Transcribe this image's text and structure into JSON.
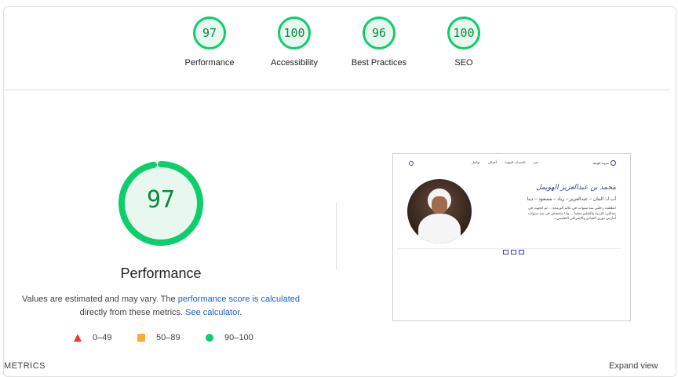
{
  "categories": [
    {
      "score": "97",
      "label": "Performance"
    },
    {
      "score": "100",
      "label": "Accessibility"
    },
    {
      "score": "96",
      "label": "Best Practices"
    },
    {
      "score": "100",
      "label": "SEO"
    }
  ],
  "performance": {
    "score": "97",
    "score_fraction": 0.97,
    "title": "Performance",
    "desc_prefix": "Values are estimated and may vary. The ",
    "desc_link1": "performance score is calculated",
    "desc_middle": " directly from these metrics. ",
    "desc_link2": "See calculator",
    "desc_suffix": "."
  },
  "legend": {
    "fail": "0–49",
    "average": "50–89",
    "pass": "90–100"
  },
  "colors": {
    "pass": "#0cce6b",
    "average": "#ffaa33",
    "fail": "#ff3333",
    "link": "#1a5fc8"
  },
  "screenshot": {
    "logo_text": "مدونة الهدهد",
    "nav_items": [
      "عني",
      "الخدمات المهنية",
      "أعمالي",
      "تواصل"
    ],
    "name": "محمد بن عبدالعزيز الهويمل",
    "subtitle": "أب لـ: البتان – عبدالعزيز – رياد – مسعود – دينا",
    "bio_line1": "انطلقت رحلتي منذ سنوات في عالم البرمجة ... ثم اتجهت في",
    "bio_line2": "مجالين: التربية والتعليم معلماً ... وأنا متخصص في منذ سنوات",
    "bio_line3": "أمارس دوري القيادي والإشرافي التعليمي..."
  },
  "footer": {
    "metrics": "METRICS",
    "expand": "Expand view"
  }
}
